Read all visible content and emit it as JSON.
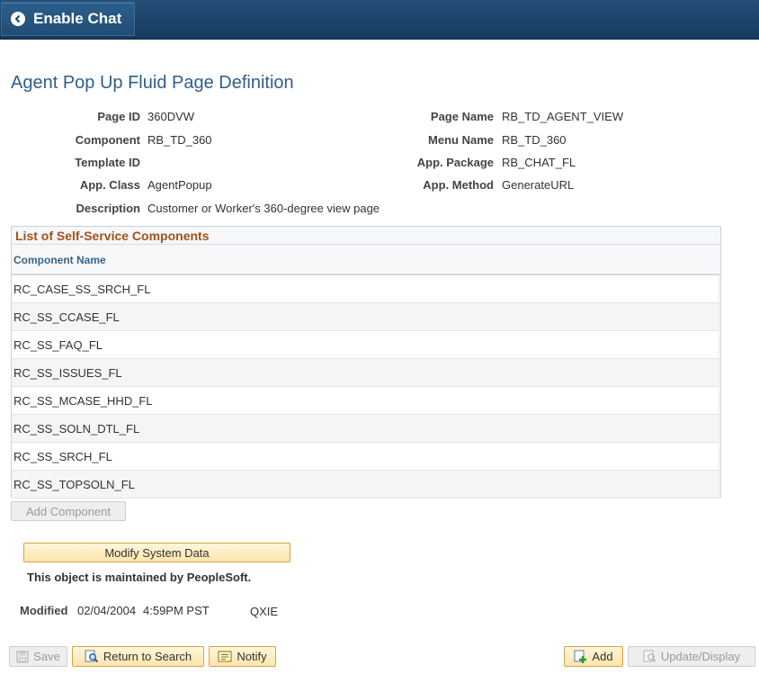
{
  "header": {
    "back_label": "Enable Chat"
  },
  "page": {
    "title": "Agent Pop Up Fluid Page Definition"
  },
  "fields": {
    "page_id_label": "Page ID",
    "page_id_value": "360DVW",
    "component_label": "Component",
    "component_value": "RB_TD_360",
    "template_id_label": "Template ID",
    "template_id_value": "",
    "app_class_label": "App. Class",
    "app_class_value": "AgentPopup",
    "description_label": "Description",
    "description_value": "Customer or Worker's 360-degree view page",
    "page_name_label": "Page Name",
    "page_name_value": "RB_TD_AGENT_VIEW",
    "menu_name_label": "Menu Name",
    "menu_name_value": "RB_TD_360",
    "app_package_label": "App. Package",
    "app_package_value": "RB_CHAT_FL",
    "app_method_label": "App. Method",
    "app_method_value": "GenerateURL"
  },
  "grid": {
    "title": "List of Self-Service Components",
    "column_header": "Component Name",
    "rows": [
      "RC_CASE_SS_SRCH_FL",
      "RC_SS_CCASE_FL",
      "RC_SS_FAQ_FL",
      "RC_SS_ISSUES_FL",
      "RC_SS_MCASE_HHD_FL",
      "RC_SS_SOLN_DTL_FL",
      "RC_SS_SRCH_FL",
      "RC_SS_TOPSOLN_FL"
    ],
    "add_button": "Add Component"
  },
  "system": {
    "modify_button": "Modify System Data",
    "note": "This object is maintained by PeopleSoft."
  },
  "modified": {
    "label": "Modified",
    "date": "02/04/2004",
    "time": "4:59PM PST",
    "user": "QXIE"
  },
  "toolbar": {
    "save": "Save",
    "return_to_search": "Return to Search",
    "notify": "Notify",
    "add": "Add",
    "update_display": "Update/Display"
  },
  "colors": {
    "banner": "#1d4468",
    "title": "#305e8a",
    "grid_title": "#a35119",
    "button_yellow": "#fde5ad"
  }
}
